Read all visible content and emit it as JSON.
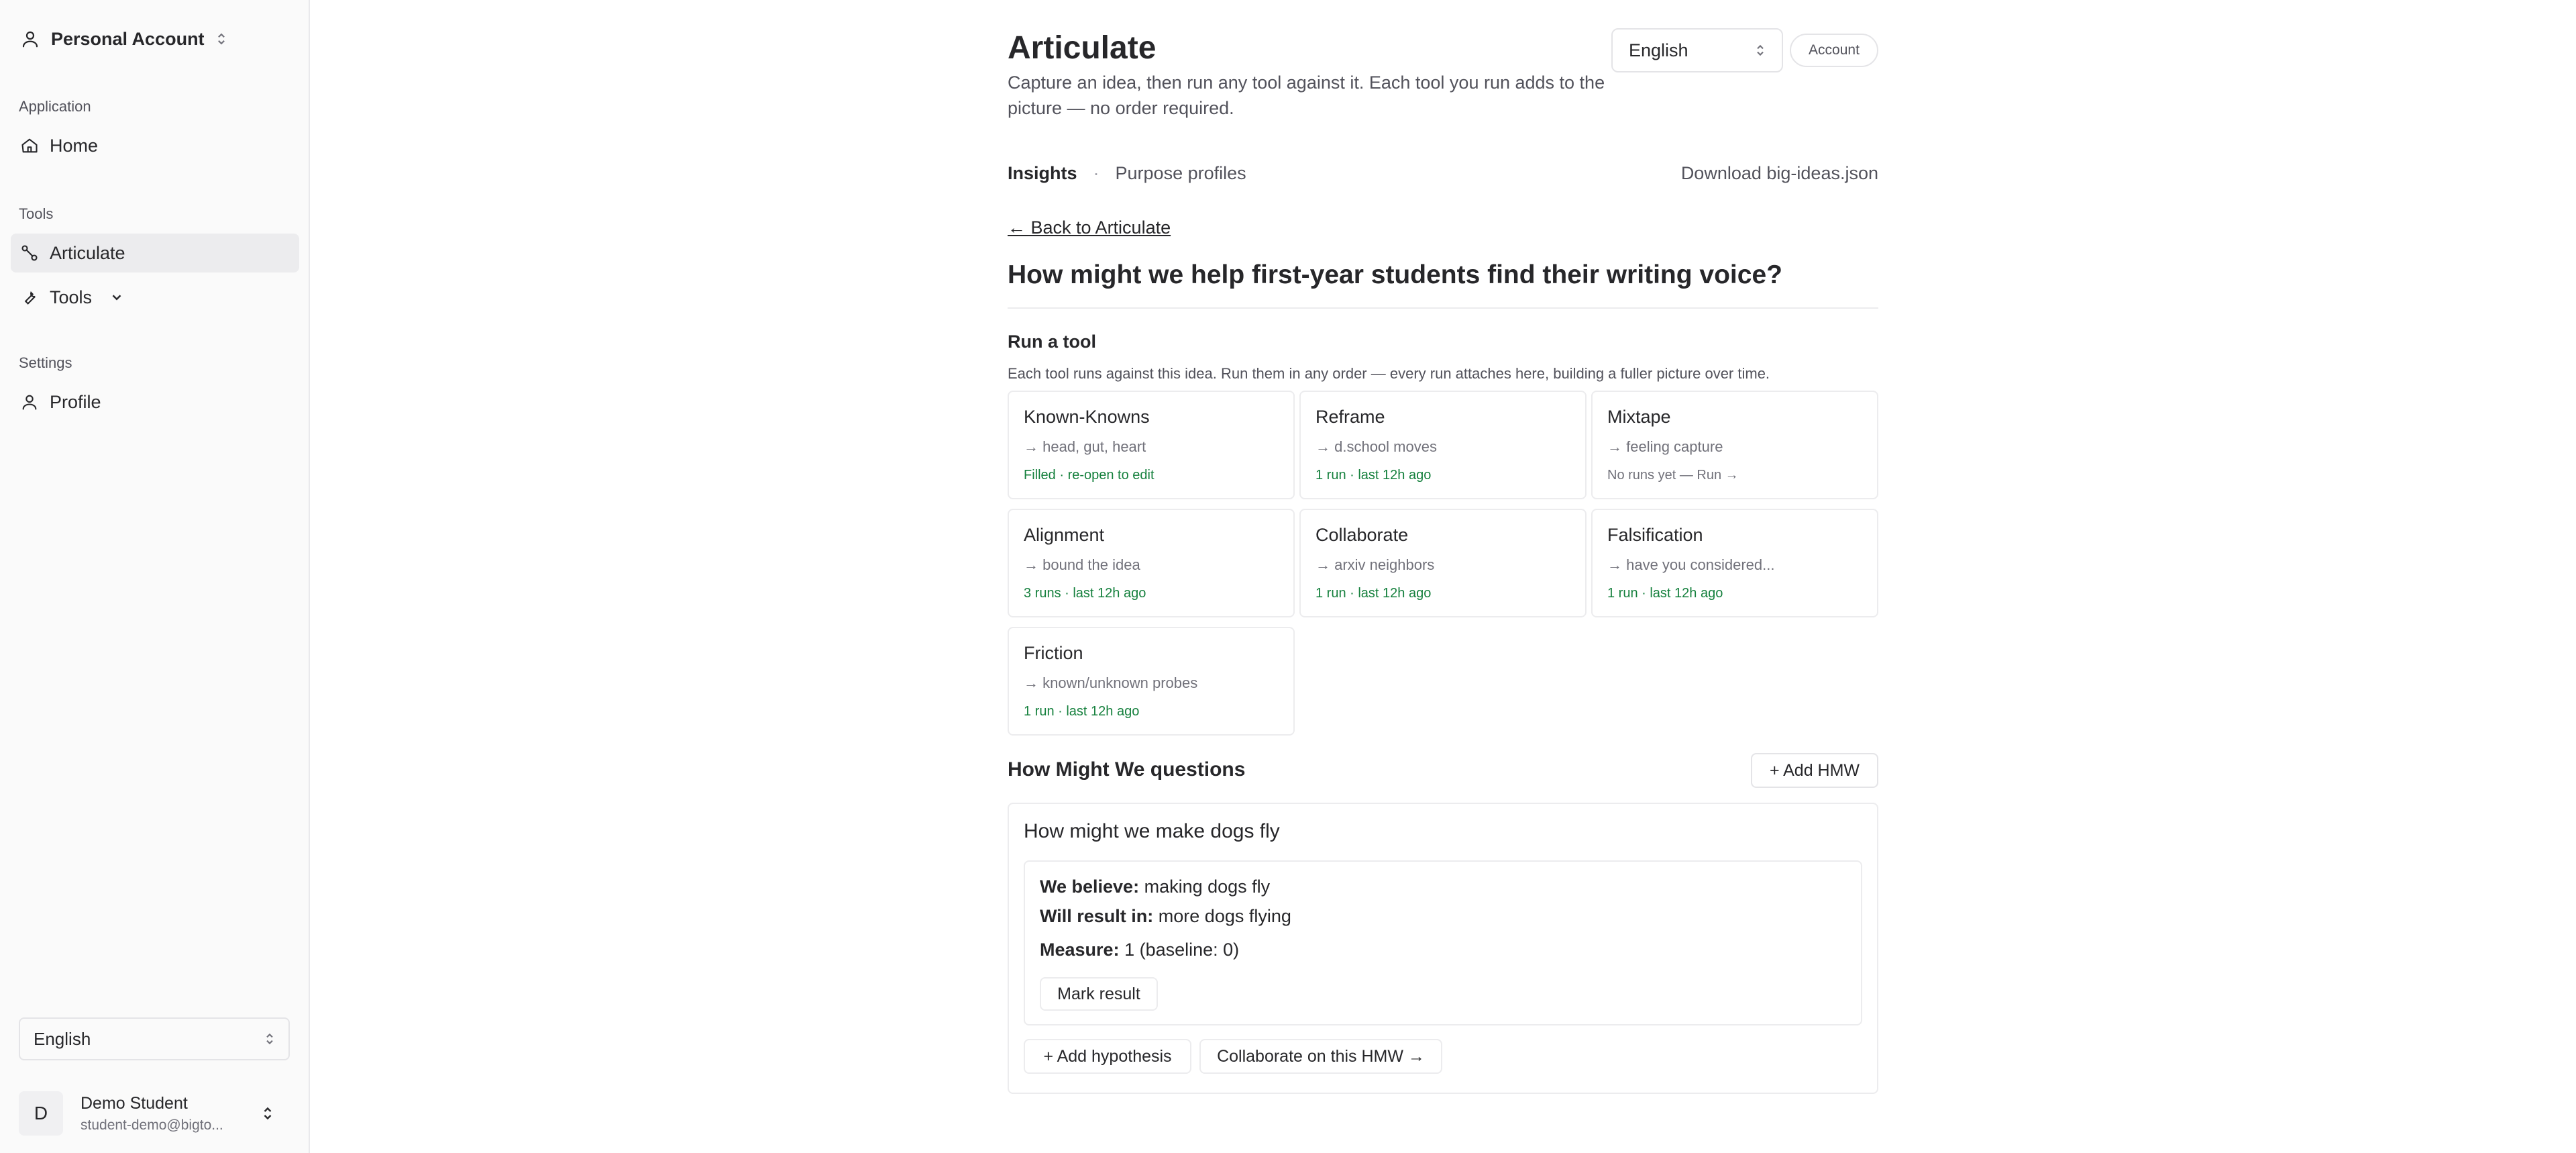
{
  "sidebar": {
    "account_label": "Personal Account",
    "groups": {
      "application": "Application",
      "tools": "Tools",
      "settings": "Settings"
    },
    "items": {
      "home": "Home",
      "articulate": "Articulate",
      "tools": "Tools",
      "profile": "Profile"
    },
    "language": "English",
    "user": {
      "initial": "D",
      "name": "Demo Student",
      "email": "student-demo@bigto..."
    }
  },
  "header": {
    "title": "Articulate",
    "description": "Capture an idea, then run any tool against it. Each tool you run adds to the picture — no order required.",
    "language": "English",
    "account_button": "Account"
  },
  "subnav": {
    "insights": "Insights",
    "separator": "·",
    "purpose_profiles": "Purpose profiles",
    "download": "Download big-ideas.json"
  },
  "back_link": "← Back to Articulate",
  "idea_title": "How might we help first-year students find their writing voice?",
  "run_tool": {
    "title": "Run a tool",
    "description": "Each tool runs against this idea. Run them in any order — every run attaches here, building a fuller picture over time.",
    "tools": [
      {
        "name": "Known-Knowns",
        "sub": "→ head, gut, heart",
        "status": "Filled · re-open to edit"
      },
      {
        "name": "Reframe",
        "sub": "→ d.school moves",
        "status": "1 run · last 12h ago"
      },
      {
        "name": "Mixtape",
        "sub": "→ feeling capture",
        "status": "No runs yet — Run →"
      },
      {
        "name": "Alignment",
        "sub": "→ bound the idea",
        "status": "3 runs · last 12h ago"
      },
      {
        "name": "Collaborate",
        "sub": "→ arxiv neighbors",
        "status": "1 run · last 12h ago"
      },
      {
        "name": "Falsification",
        "sub": "→ have you considered...",
        "status": "1 run · last 12h ago"
      },
      {
        "name": "Friction",
        "sub": "→ known/unknown probes",
        "status": "1 run · last 12h ago"
      }
    ]
  },
  "hmw": {
    "title": "How Might We questions",
    "add_button": "+ Add HMW",
    "question": "How might we make dogs fly",
    "hypothesis": {
      "believe_label": "We believe:",
      "believe_value": "making dogs fly",
      "result_label": "Will result in:",
      "result_value": "more dogs flying",
      "measure_label": "Measure:",
      "measure_value": "1 (baseline: 0)",
      "mark_button": "Mark result"
    },
    "add_hypothesis": "+ Add hypothesis",
    "collaborate": "Collaborate on this HMW →"
  }
}
